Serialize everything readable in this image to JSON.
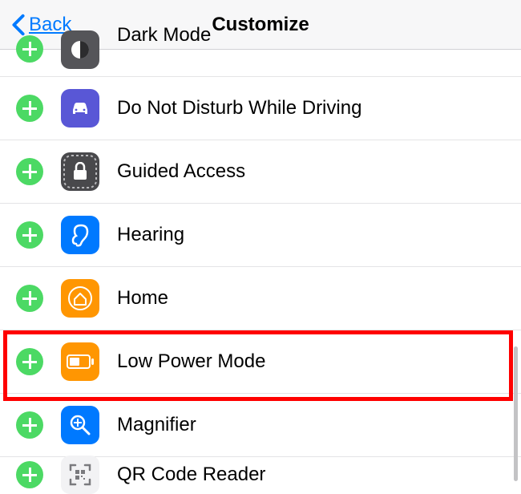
{
  "header": {
    "back_label": "Back",
    "title": "Customize"
  },
  "items": [
    {
      "id": "dark-mode",
      "label": "Dark Mode",
      "icon_bg": "#555559"
    },
    {
      "id": "dnd-driving",
      "label": "Do Not Disturb While Driving",
      "icon_bg": "#5957d6"
    },
    {
      "id": "guided-access",
      "label": "Guided Access",
      "icon_bg": "#49494c"
    },
    {
      "id": "hearing",
      "label": "Hearing",
      "icon_bg": "#0079ff"
    },
    {
      "id": "home",
      "label": "Home",
      "icon_bg": "#ff9602"
    },
    {
      "id": "low-power-mode",
      "label": "Low Power Mode",
      "icon_bg": "#ff9602"
    },
    {
      "id": "magnifier",
      "label": "Magnifier",
      "icon_bg": "#0079ff"
    },
    {
      "id": "qr-code-reader",
      "label": "QR Code Reader",
      "icon_bg": "#f2f2f4"
    }
  ],
  "highlighted_index": 5,
  "colors": {
    "add_button": "#4cd964",
    "ios_blue": "#007aff",
    "highlight": "#ff0000"
  }
}
